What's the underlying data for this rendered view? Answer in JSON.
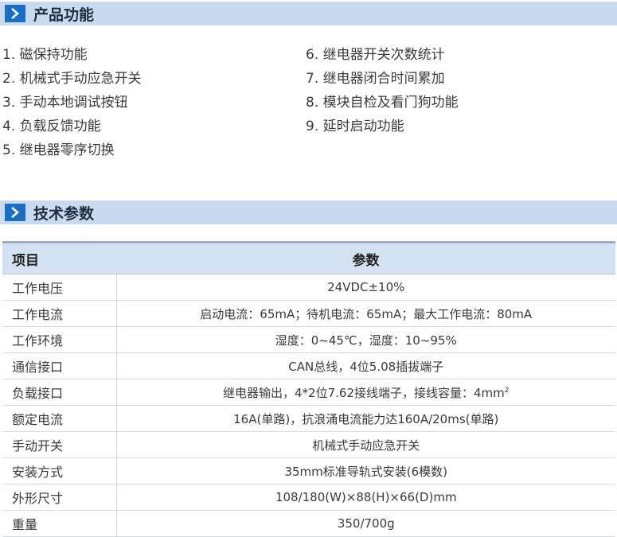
{
  "section1": {
    "title": "产品功能",
    "icon": "chevron-right-icon"
  },
  "features": [
    "1. 磁保持功能",
    "2. 机械式手动应急开关",
    "3. 手动本地调试按钮",
    "4. 负载反馈功能",
    "5. 继电器零序切换",
    "6. 继电器开关次数统计",
    "7. 继电器闭合时间累加",
    "8. 模块自检及看门狗功能",
    "9. 延时启动功能"
  ],
  "section2": {
    "title": "技术参数",
    "icon": "chevron-right-icon"
  },
  "table": {
    "headers": [
      "项目",
      "参数"
    ],
    "rows": [
      {
        "item": "工作电压",
        "value": "24VDC±10%"
      },
      {
        "item": "工作电流",
        "value": "启动电流：65mA；待机电流：65mA；最大工作电流：80mA"
      },
      {
        "item": "工作环境",
        "value": "湿度：0~45℃，湿度：10~95%"
      },
      {
        "item": "通信接口",
        "value": "CAN总线，4位5.08插拔端子"
      },
      {
        "item": "负载接口",
        "value": "继电器输出，4*2位7.62接线端子，接线容量：4mm",
        "sup": "2"
      },
      {
        "item": "额定电流",
        "value": "16A(单路)，抗浪涌电流能力达160A/20ms(单路)"
      },
      {
        "item": "手动开关",
        "value": "机械式手动应急开关"
      },
      {
        "item": "安装方式",
        "value": "35mm标准导轨式安装(6模数)"
      },
      {
        "item": "外形尺寸",
        "value": "108/180(W)×88(H)×66(D)mm"
      },
      {
        "item": "重量",
        "value": "350/700g"
      }
    ]
  },
  "colors": {
    "bar_bg": "#c9daf1",
    "icon_bg": "#1a6fc4",
    "header_bg": "#d4e1f2"
  }
}
